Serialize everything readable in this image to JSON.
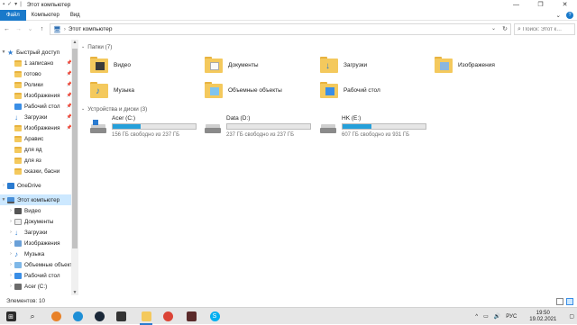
{
  "title_bar": {
    "title": "Этот компьютер",
    "quick_access_glyphs": [
      "▪",
      "✓",
      "▾",
      "|"
    ],
    "controls": [
      "—",
      "❐",
      "✕"
    ]
  },
  "ribbon": {
    "tabs": [
      "Файл",
      "Компьютер",
      "Вид"
    ],
    "expand_glyph": "⌄",
    "help_glyph": "?"
  },
  "address": {
    "back": "←",
    "forward": "→",
    "recent": "⌄",
    "up": "↑",
    "pc_glyph": "🖥",
    "separator": "›",
    "path": "Этот компьютер",
    "dropdown": "⌄",
    "refresh": "↻"
  },
  "search": {
    "placeholder": "Поиск: Этот к…"
  },
  "nav": {
    "quick_access": "Быстрый доступ",
    "items": [
      {
        "label": "1 записано",
        "pinned": true
      },
      {
        "label": "готово",
        "pinned": true
      },
      {
        "label": "Ролики",
        "pinned": true
      },
      {
        "label": "Изображения",
        "pinned": true
      },
      {
        "label": "Рабочий стол",
        "pinned": true
      },
      {
        "label": "Загрузки",
        "pinned": true
      },
      {
        "label": "Изображения",
        "pinned": true
      },
      {
        "label": "Аравис",
        "pinned": false
      },
      {
        "label": "для яд",
        "pinned": false
      },
      {
        "label": "для яз",
        "pinned": false
      },
      {
        "label": "сказки, басни",
        "pinned": false
      }
    ],
    "onedrive": "OneDrive",
    "this_pc": "Этот компьютер",
    "pc_children": [
      "Видео",
      "Документы",
      "Загрузки",
      "Изображения",
      "Музыка",
      "Объемные объекты",
      "Рабочий стол",
      "Acer (C:)"
    ],
    "pin_glyph": "📌",
    "scroll_up": "▲",
    "scroll_down": "▼"
  },
  "content": {
    "folders_header": "Папки (7)",
    "folders": [
      "Видео",
      "Документы",
      "Загрузки",
      "Изображения",
      "Музыка",
      "Объемные объекты",
      "Рабочий стол"
    ],
    "drives_header": "Устройства и диски (3)",
    "drives": [
      {
        "name": "Acer (C:)",
        "free": "156 ГБ свободно из 237 ГБ",
        "used_fraction": 0.34
      },
      {
        "name": "Data (D:)",
        "free": "237 ГБ свободно из 237 ГБ",
        "used_fraction": 0.0
      },
      {
        "name": "HK (E:)",
        "free": "607 ГБ свободно из 931 ГБ",
        "used_fraction": 0.35
      }
    ]
  },
  "status": {
    "count": "Элементов: 10"
  },
  "taskbar": {
    "lang": "РУС",
    "time": "19:50",
    "date": "19.02.2021",
    "tray_glyphs": [
      "^",
      "▭",
      "🔊"
    ],
    "notification_glyph": "▢"
  },
  "colors": {
    "accent": "#1979ca",
    "folder": "#f4c95d",
    "drive_fill": "#26a0da",
    "selection": "#cce8ff"
  }
}
